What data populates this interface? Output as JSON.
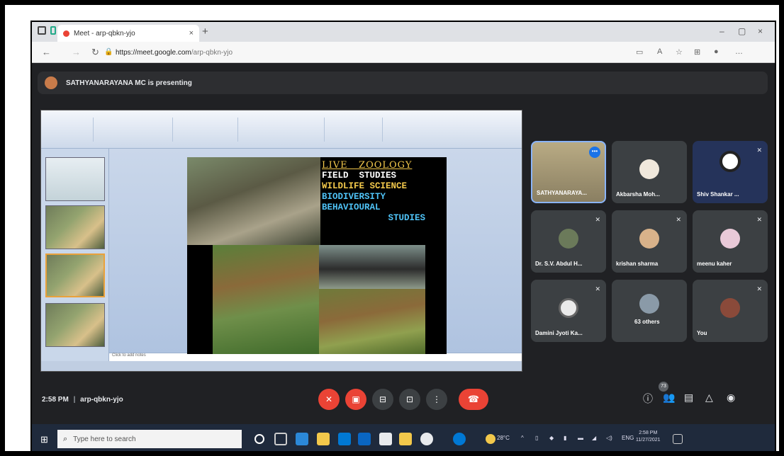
{
  "browser": {
    "tab_title": "Meet - arp-qbkn-yjo",
    "tab_close": "×",
    "new_tab": "+",
    "url_host": "https://meet.google.com",
    "url_path": "/arp-qbkn-yjo",
    "window_controls": [
      "–",
      "▢",
      "×"
    ]
  },
  "meet": {
    "presenting_text": "SATHYANARAYANA MC is presenting",
    "meeting_time": "2:58 PM",
    "meeting_code": "arp-qbkn-yjo",
    "participants_badge": "73"
  },
  "slide": {
    "title": "LIVE   ZOOLOGY",
    "lines": [
      {
        "text": "FIELD  STUDIES",
        "color": "#ffffff"
      },
      {
        "text": "WILDLIFE SCIENCE",
        "color": "#f2c84b"
      },
      {
        "text": "BIODIVERSITY",
        "color": "#4fc3f7"
      },
      {
        "text": "BEHAVIOURAL",
        "color": "#4fc3f7"
      },
      {
        "text": "STUDIES",
        "color": "#4fc3f7"
      }
    ],
    "notes_placeholder": "Click to add notes"
  },
  "tiles": [
    {
      "name": "SATHYANARAYA...",
      "kind": "video"
    },
    {
      "name": "Akbarsha Moh...",
      "kind": "avatar"
    },
    {
      "name": "Shiv Shankar ...",
      "kind": "logo"
    },
    {
      "name": "Dr. S.V. Abdul H...",
      "kind": "avatar"
    },
    {
      "name": "krishan sharma",
      "kind": "avatar"
    },
    {
      "name": "meenu kaher",
      "kind": "avatar"
    },
    {
      "name": "Damini Jyoti Ka...",
      "kind": "avatar"
    },
    {
      "name": "63 others",
      "kind": "group"
    },
    {
      "name": "You",
      "kind": "avatar"
    }
  ],
  "taskbar": {
    "search_placeholder": "Type here to search",
    "weather": "28°C",
    "lang": "ENG",
    "time": "2:58 PM",
    "date": "11/27/2021"
  },
  "colors": {
    "meet_bg": "#202124",
    "tile_bg": "#3c4043",
    "danger": "#ea4335",
    "accent": "#8ab4f8"
  }
}
